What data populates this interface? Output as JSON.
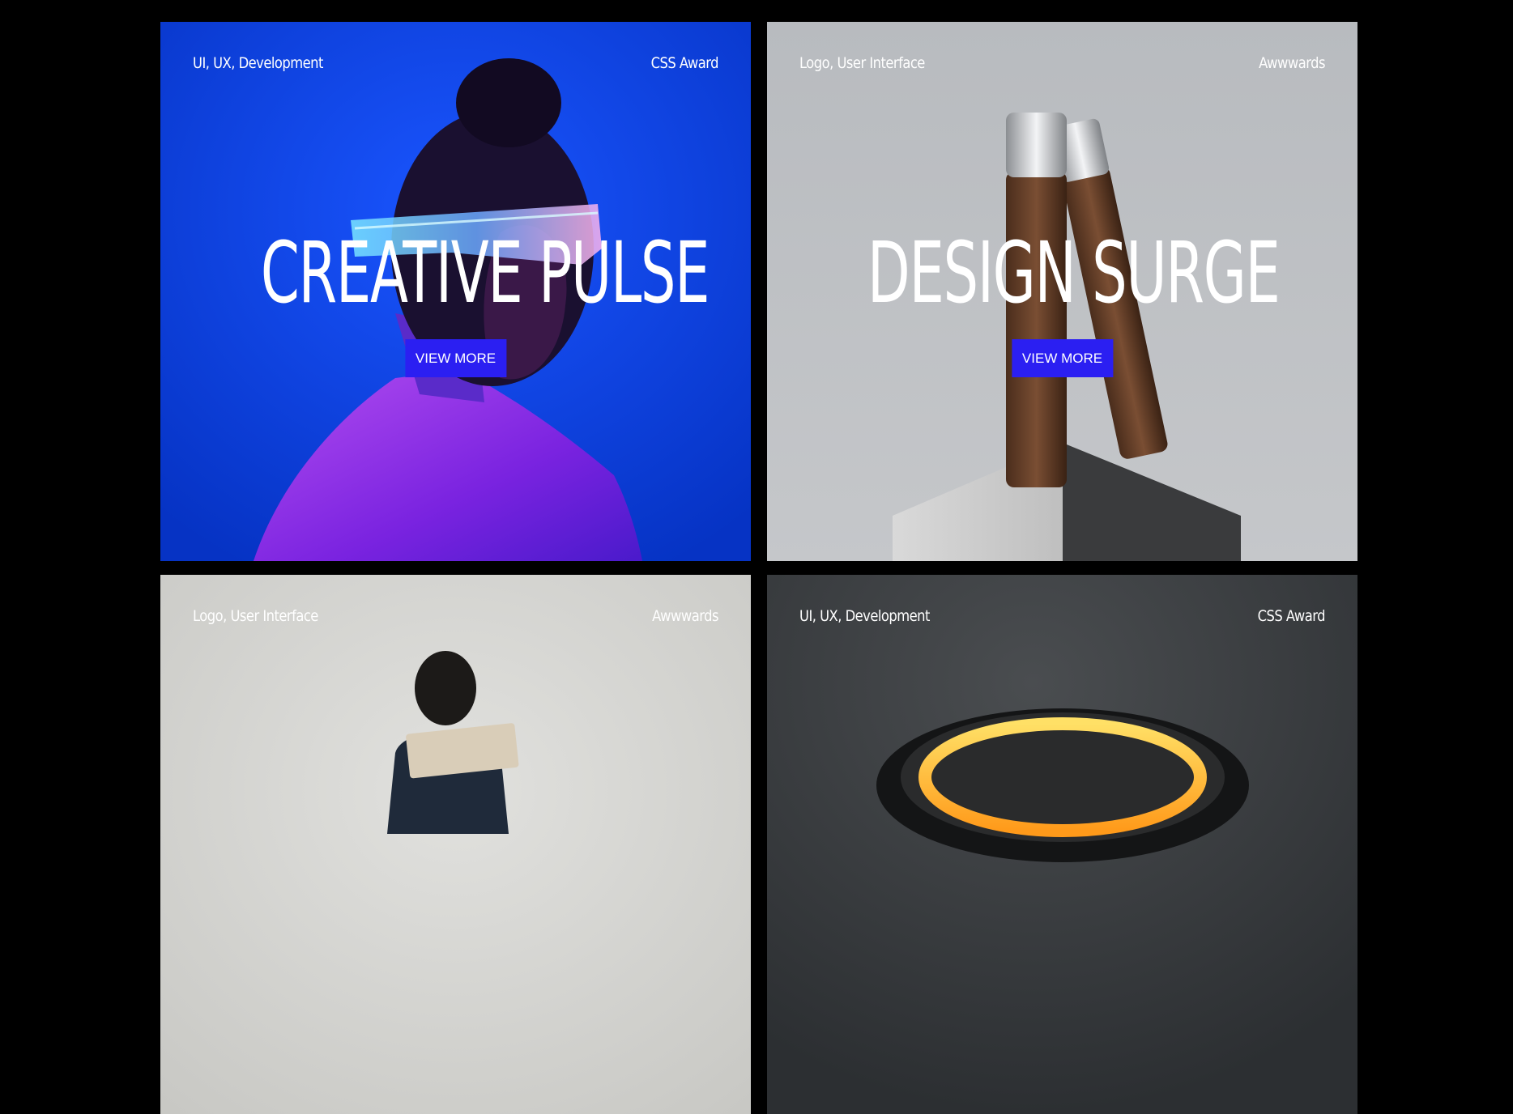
{
  "cards": [
    {
      "tags": "UI, UX, Development",
      "award": "CSS Award",
      "title": "CREATIVE PULSE",
      "cta": "VIEW MORE",
      "bg": "#0b3ed8"
    },
    {
      "tags": "Logo, User Interface",
      "award": "Awwwards",
      "title": "DESIGN SURGE",
      "cta": "VIEW MORE",
      "bg": "#b9bcc0"
    },
    {
      "tags": "Logo, User Interface",
      "award": "Awwwards",
      "title": "",
      "cta": "",
      "bg": "#d2d2cf"
    },
    {
      "tags": "UI, UX, Development",
      "award": "CSS Award",
      "title": "",
      "cta": "",
      "bg": "#3a3d40"
    }
  ],
  "colors": {
    "page_bg": "#000000",
    "button_bg": "#2b1ff2",
    "text": "#ffffff"
  }
}
